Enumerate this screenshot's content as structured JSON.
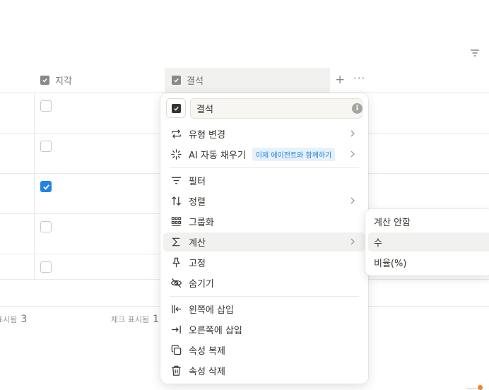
{
  "table": {
    "headers": [
      {
        "key": "late",
        "label": "지각"
      },
      {
        "key": "absent",
        "label": "결석"
      }
    ],
    "rows": [
      {
        "late_checked": false
      },
      {
        "late_checked": false
      },
      {
        "late_checked": true
      },
      {
        "late_checked": false
      },
      {
        "late_checked": false
      }
    ],
    "footer": [
      {
        "label": "표시됨",
        "count": "3"
      },
      {
        "label": "체크 표시됨",
        "count": "1"
      }
    ]
  },
  "menu": {
    "property_name": "결석",
    "info_icon": "i",
    "items": [
      {
        "id": "change-type",
        "icon": "swap-icon",
        "label": "유형 변경",
        "submenu": true
      },
      {
        "id": "ai-autofill",
        "icon": "sparkle-icon",
        "label": "AI 자동 채우기",
        "badge": "이제 에이전트와 함께하기",
        "submenu": true
      },
      {
        "id": "filter",
        "icon": "filter-icon",
        "label": "필터",
        "submenu": false
      },
      {
        "id": "sort",
        "icon": "sort-icon",
        "label": "정렬",
        "submenu": true
      },
      {
        "id": "group",
        "icon": "group-icon",
        "label": "그룹화",
        "submenu": false
      },
      {
        "id": "calculate",
        "icon": "sigma-icon",
        "label": "계산",
        "submenu": true,
        "active": true
      },
      {
        "id": "pin",
        "icon": "pin-icon",
        "label": "고정",
        "submenu": false
      },
      {
        "id": "hide",
        "icon": "eye-off-icon",
        "label": "숨기기",
        "submenu": false
      },
      {
        "id": "insert-left",
        "icon": "insert-left-icon",
        "label": "왼쪽에 삽입",
        "submenu": false
      },
      {
        "id": "insert-right",
        "icon": "insert-right-icon",
        "label": "오른쪽에 삽입",
        "submenu": false
      },
      {
        "id": "duplicate",
        "icon": "copy-icon",
        "label": "속성 복제",
        "submenu": false
      },
      {
        "id": "delete",
        "icon": "trash-icon",
        "label": "속성 삭제",
        "submenu": false
      }
    ]
  },
  "submenu": {
    "items": [
      {
        "label": "계산 안함",
        "active": false
      },
      {
        "label": "수",
        "active": true
      },
      {
        "label": "비율(%)",
        "active": false
      }
    ]
  },
  "colors": {
    "accent": "#2383e2",
    "hover": "#f1f1ef",
    "text": "#37352f",
    "muted": "#787774"
  }
}
